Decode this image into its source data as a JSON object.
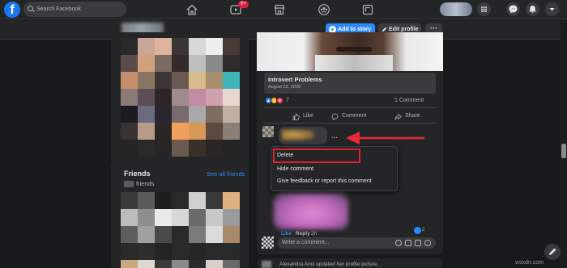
{
  "topbar": {
    "search_placeholder": "Search Facebook",
    "logo_letter": "f",
    "video_badge": "9+"
  },
  "profile_actions": {
    "add_story": "Add to story",
    "edit_profile": "Edit profile",
    "more": "···"
  },
  "friends": {
    "title": "Friends",
    "see_all": "See all friends",
    "count_label": "friends"
  },
  "post": {
    "link_title": "Introvert Problems",
    "link_date": "August 23, 2020",
    "reaction_count": "7",
    "comment_count": "1 Comment",
    "actions": {
      "like": "Like",
      "comment": "Comment",
      "share": "Share"
    }
  },
  "comment": {
    "more": "···",
    "like": "Like",
    "reply": "Reply",
    "time": "2h",
    "like_count": "2"
  },
  "comment_menu": {
    "items": [
      "Delete",
      "Hide comment",
      "Give feedback or report this comment"
    ],
    "highlighted": "Delete"
  },
  "write_comment": {
    "placeholder": "Write a comment..."
  },
  "next_post": {
    "text": "Alexandra Arici updated her profile picture."
  },
  "watermark": "wsxdn.com",
  "colors": {
    "background": "#18191a",
    "surface": "#242526",
    "accent": "#2d88ff",
    "highlight": "#e0202a",
    "arrow": "#e8293a"
  },
  "icons": [
    "facebook-logo",
    "search-icon",
    "home-icon",
    "watch-icon",
    "marketplace-icon",
    "groups-icon",
    "gaming-icon",
    "menu-grid-icon",
    "messenger-icon",
    "bell-icon",
    "caret-down-icon",
    "like-icon",
    "comment-icon",
    "share-icon",
    "emoji-icon",
    "camera-icon",
    "gif-icon",
    "sticker-icon"
  ]
}
